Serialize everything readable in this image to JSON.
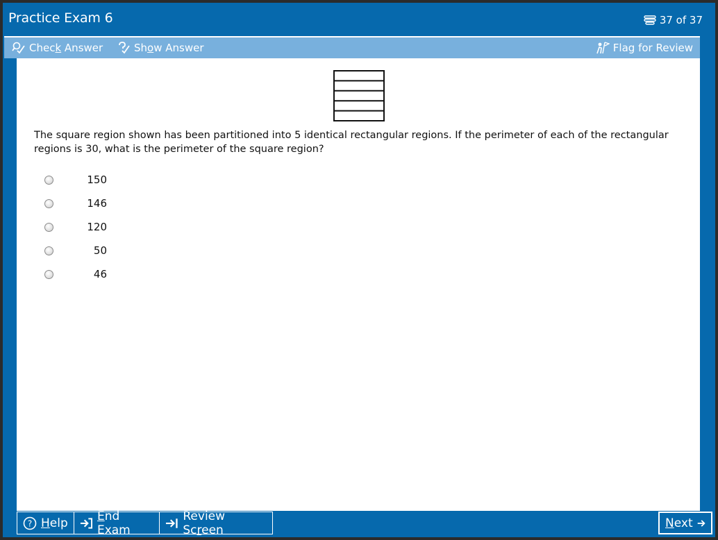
{
  "window": {
    "title": "Practice Exam 6",
    "progress": "37 of 37"
  },
  "toolbar": {
    "check_answer": {
      "pre": "Chec",
      "underlined": "k",
      "post": " Answer",
      "icon": "magnifier-check-icon"
    },
    "show_answer": {
      "pre": "Sh",
      "underlined": "o",
      "post": "w Answer",
      "icon": "question-check-icon"
    },
    "flag_review": {
      "label": "Flag for Review",
      "icon": "flag-person-icon"
    }
  },
  "question": {
    "figure": {
      "type": "square-partition",
      "rectangles": 5
    },
    "text": "The square region shown has been partitioned into 5 identical rectangular regions. If the perimeter of each of the rectangular regions is 30, what is the perimeter of the square region?",
    "choices": [
      "150",
      "146",
      "120",
      "50",
      "46"
    ],
    "selected": null
  },
  "footer": {
    "help": {
      "underlined": "H",
      "post": "elp",
      "icon": "help-circle-icon"
    },
    "end_exam": {
      "underlined": "E",
      "post": "nd Exam",
      "icon": "exit-icon"
    },
    "review_screen": {
      "pre": "Review Sc",
      "underlined": "r",
      "post": "een",
      "icon": "skip-to-end-icon"
    },
    "next": {
      "underlined": "N",
      "post": "ext",
      "icon": "arrow-right-icon"
    }
  },
  "colors": {
    "frame_blue": "#0669ad",
    "toolbar_blue": "#78b0dd",
    "content_bg": "#ffffff"
  }
}
